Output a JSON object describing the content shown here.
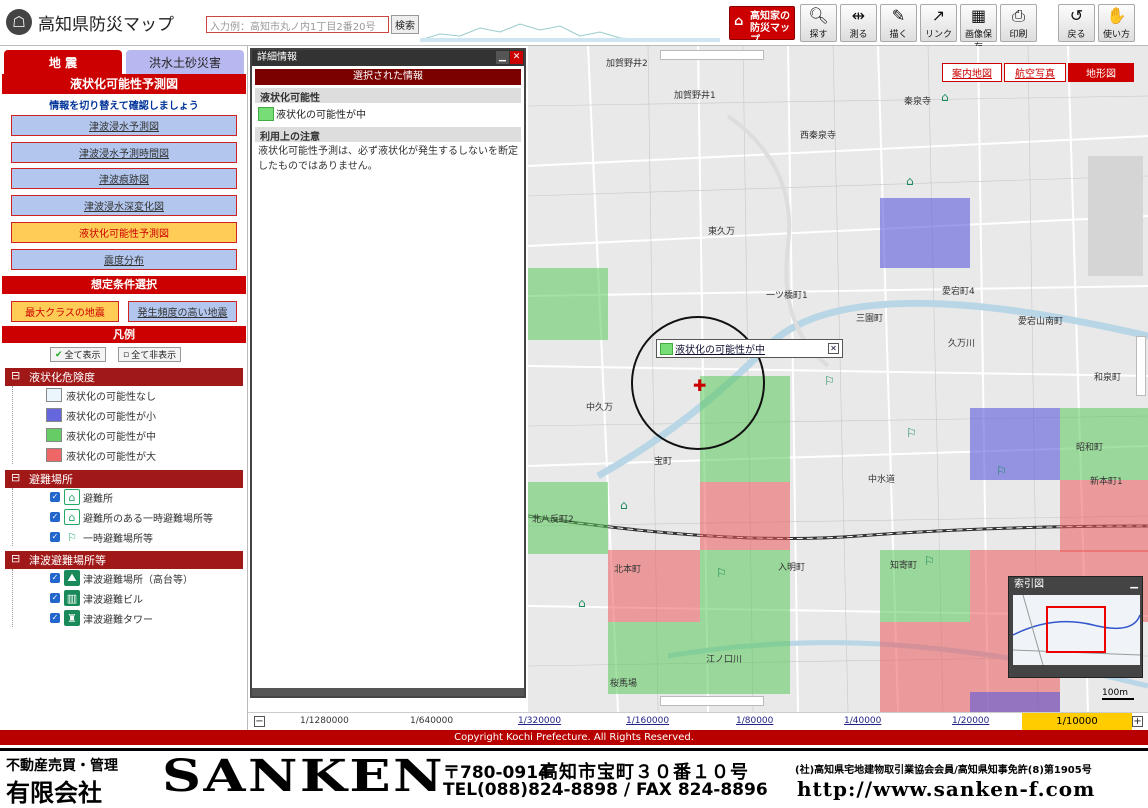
{
  "header": {
    "title": "高知県防災マップ",
    "search_placeholder": "入力例：高知市丸ノ内1丁目2番20号",
    "search_button": "検索",
    "kochi_button": "高知家の防災マップ",
    "tools": [
      {
        "label": "探す",
        "icon": "magnifier-icon"
      },
      {
        "label": "測る",
        "icon": "ruler-icon"
      },
      {
        "label": "描く",
        "icon": "draw-icon"
      },
      {
        "label": "リンク",
        "icon": "link-icon"
      },
      {
        "label": "画像保存",
        "icon": "image-save-icon"
      },
      {
        "label": "印刷",
        "icon": "print-icon"
      },
      {
        "label": "戻る",
        "icon": "back-icon"
      },
      {
        "label": "使い方",
        "icon": "help-icon"
      }
    ]
  },
  "left": {
    "tab_eq": "地 震",
    "tab_flood": "洪水土砂災害",
    "panel_title": "液状化可能性予測図",
    "info": "情報を切り替えて確認しましょう",
    "buttons": [
      "津波浸水予測図",
      "津波浸水予測時間図",
      "津波痕跡図",
      "津波浸水深変化図",
      "液状化可能性予測図",
      "震度分布"
    ],
    "cond_title": "想定条件選択",
    "cond_max": "最大クラスの地震",
    "cond_freq": "発生頻度の高い地震",
    "legend_title": "凡例",
    "show_all": "全て表示",
    "hide_all": "全て非表示",
    "sections": [
      {
        "name": "液状化危険度",
        "items": [
          {
            "label": "液状化の可能性なし",
            "color": "#eaf6fb"
          },
          {
            "label": "液状化の可能性が小",
            "color": "#6666dd"
          },
          {
            "label": "液状化の可能性が中",
            "color": "#66cc66"
          },
          {
            "label": "液状化の可能性が大",
            "color": "#ee6666"
          }
        ]
      },
      {
        "name": "避難場所",
        "items": [
          {
            "label": "避難所"
          },
          {
            "label": "避難所のある一時避難場所等"
          },
          {
            "label": "一時避難場所等"
          }
        ]
      },
      {
        "name": "津波避難場所等",
        "items": [
          {
            "label": "津波避難場所（高台等）"
          },
          {
            "label": "津波避難ビル"
          },
          {
            "label": "津波避難タワー"
          }
        ]
      }
    ]
  },
  "detail": {
    "title": "詳細情報",
    "selected": "選択された情報",
    "head1": "液状化可能性",
    "item": "液状化の可能性が中",
    "head2": "利用上の注意",
    "note": "液状化可能性予測は、必ず液状化が発生するしないを断定したものではありません。"
  },
  "map": {
    "tabs": [
      "案内地図",
      "航空写真",
      "地形図"
    ],
    "popup": "液状化の可能性が中",
    "index_title": "索引図",
    "scale": "100m",
    "labels": [
      "加賀野井2",
      "加賀野井1",
      "西秦泉寺",
      "秦泉寺",
      "東久万",
      "一ツ橋町1",
      "三園町",
      "愛宕町4",
      "愛宕山南町",
      "中久万",
      "宝町",
      "北八反町2",
      "北本町",
      "中水道",
      "昭和町",
      "新本町1",
      "桜馬場",
      "江ノ口川",
      "久万川",
      "和泉町",
      "入明町",
      "知寄町"
    ]
  },
  "zoom": {
    "levels": [
      "1/1280000",
      "1/640000",
      "1/320000",
      "1/160000",
      "1/80000",
      "1/40000",
      "1/20000"
    ],
    "current": "1/10000"
  },
  "copyright": "Copyright Kochi Prefecture. All Rights Reserved.",
  "footer": {
    "tag": "不動産売買・管理",
    "company": "有限会社",
    "brand": "SANKEN",
    "postal": "〒780-0914",
    "address": "高知市宝町３０番１０号",
    "tel": "TEL(088)824-8898 / FAX 824-8896",
    "assoc": "(社)高知県宅地建物取引業協会会員/高知県知事免許(8)第1905号",
    "url": "http://www.sanken-f.com"
  }
}
